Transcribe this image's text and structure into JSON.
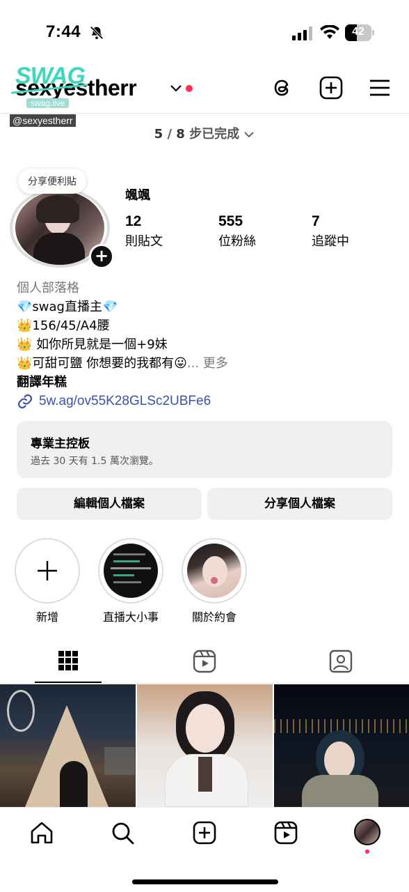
{
  "status_bar": {
    "time": "7:44",
    "battery": "42"
  },
  "header": {
    "username": "sexyestherr",
    "swag_logo_text": "SWAG",
    "swag_sub": "swag.live",
    "handle_tag": "@sexyestherr"
  },
  "progress": {
    "done": "5",
    "total": "8",
    "label": "步已完成"
  },
  "profile": {
    "note": "分享便利貼",
    "display_name": "颯颯",
    "stats": [
      {
        "num": "12",
        "label": "則貼文"
      },
      {
        "num": "555",
        "label": "位粉絲"
      },
      {
        "num": "7",
        "label": "追蹤中"
      }
    ]
  },
  "bio": {
    "category": "個人部落格",
    "line1": "💎swag直播主💎",
    "line2": "👑156/45/A4腰",
    "line3": "👑 如你所見就是一個+9妹",
    "line4": "👑可甜可鹽 你想要的我都有😛",
    "more": "... 更多",
    "translate": "翻譯年糕",
    "link": "5w.ag/ov55K28GLSc2UBFe6"
  },
  "dashboard": {
    "title": "專業主控板",
    "subtitle": "過去 30 天有 1.5 萬次瀏覽。"
  },
  "buttons": {
    "edit": "編輯個人檔案",
    "share": "分享個人檔案"
  },
  "highlights": [
    {
      "label": "新增"
    },
    {
      "label": "直播大小事"
    },
    {
      "label": "關於約會"
    }
  ],
  "colors": {
    "accent_red": "#ff2e55",
    "link": "#3d4fad",
    "button_bg": "#eff0f2"
  }
}
